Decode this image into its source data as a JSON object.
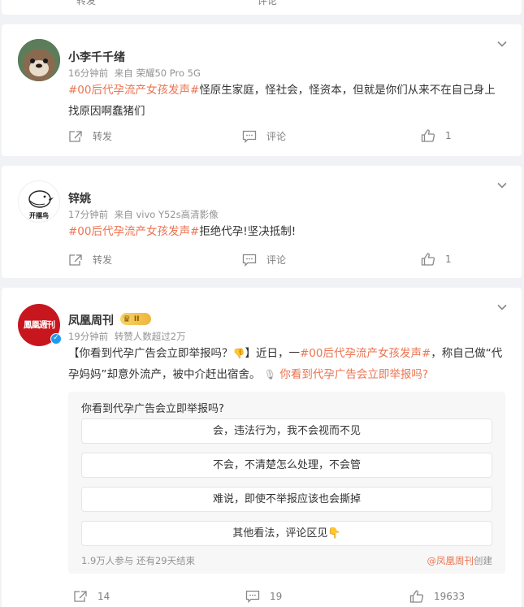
{
  "top_card": {
    "repost_label": "转发",
    "comment_label": "评论"
  },
  "posts": [
    {
      "name": "小李千千绪",
      "time": "16分钟前",
      "source": "来自 荣耀50 Pro 5G",
      "topic": "#00后代孕流产女孩发声#",
      "text": "怪原生家庭，怪社会，怪资本，但就是你们从来不在自己身上找原因啊蠢猪们",
      "repost_label": "转发",
      "comment_label": "评论",
      "like_count": "1"
    },
    {
      "name": "锌姚",
      "avatar_text": "开摆鸟",
      "time": "17分钟前",
      "source": "来自 vivo Y52s高清影像",
      "topic": "#00后代孕流产女孩发声#",
      "text": "拒绝代孕!坚决抵制!",
      "repost_label": "转发",
      "comment_label": "评论",
      "like_count": "1"
    },
    {
      "name": "凤凰周刊",
      "avatar_text": "鳳凰週刊",
      "badge": "II",
      "time": "19分钟前",
      "stats": "转赞人数超过2万",
      "text_part1": "【你看到代孕广告会立即举报吗？",
      "text_part2": "】近日，一",
      "topic": "#00后代孕流产女孩发声#",
      "text_part3": "，称自己做“代孕妈妈”却意外流产，被中介赶出宿舍。",
      "poll_link": "你看到代孕广告会立即举报吗?",
      "poll": {
        "question": "你看到代孕广告会立即举报吗?",
        "options": [
          "会，违法行为，我不会视而不见",
          "不会，不清楚怎么处理，不会管",
          "难说，即使不举报应该也会撕掉",
          "其他看法，评论区见👇"
        ],
        "participants": "1.9万人参与 还有29天结束",
        "creator": "@凤凰周刊",
        "created_label": "创建"
      },
      "repost_count": "14",
      "comment_count": "19",
      "like_count": "19633"
    }
  ]
}
